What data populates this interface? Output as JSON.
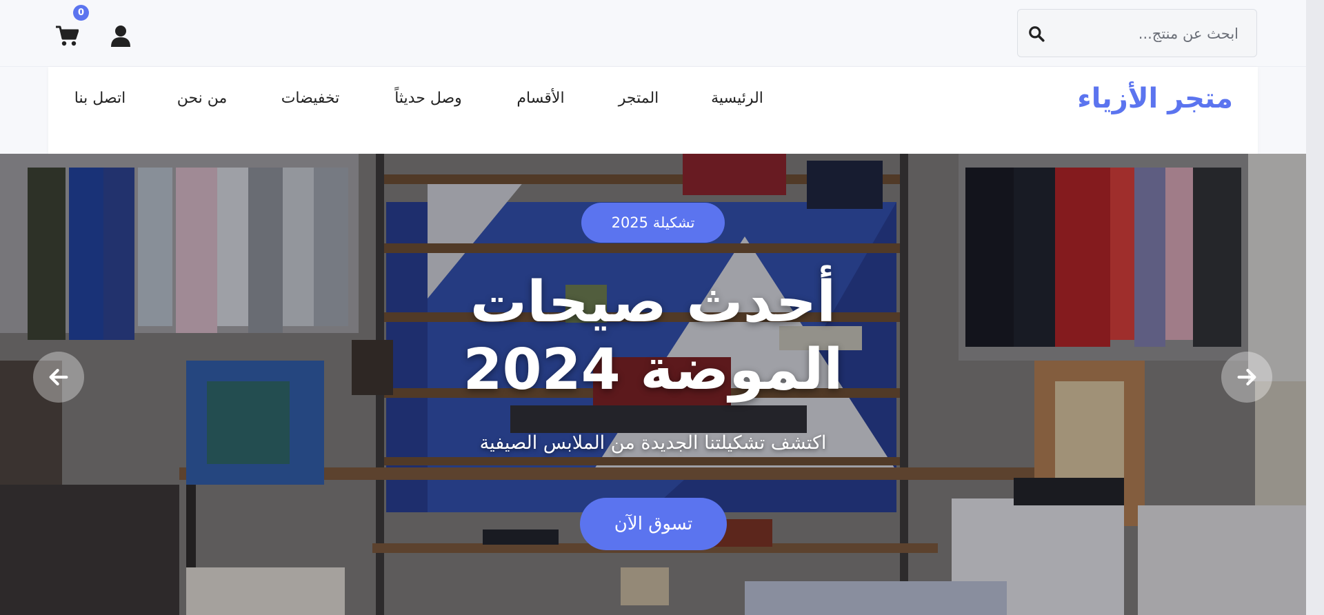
{
  "header": {
    "search_placeholder": "ابحث عن منتج...",
    "cart_count": "0",
    "icons": [
      "search-icon",
      "user-icon",
      "cart-icon"
    ]
  },
  "nav": {
    "logo": "متجر الأزياء",
    "links": [
      "الرئيسية",
      "المتجر",
      "الأقسام",
      "وصل حديثاً",
      "تخفيضات",
      "من نحن",
      "اتصل بنا"
    ]
  },
  "hero": {
    "badge": "تشكيلة 2025",
    "title_line1": "أحدث صيحات",
    "title_line2": "الموضة 2024",
    "subtitle": "اكتشف تشكيلتنا الجديدة من الملابس الصيفية",
    "cta_label": "تسوق الآن",
    "prev_icon": "arrow-left-icon",
    "next_icon": "arrow-right-icon"
  },
  "colors": {
    "accent": "#5b74ef",
    "text": "#222222",
    "topbar_bg": "#f7f8fb"
  }
}
